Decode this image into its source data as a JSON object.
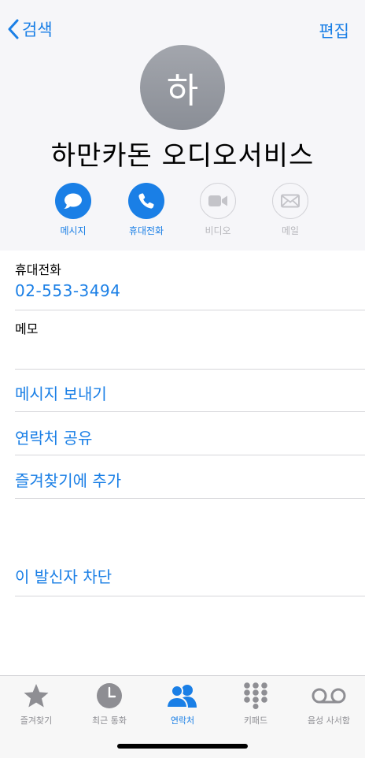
{
  "nav": {
    "back_label": "검색",
    "edit_label": "편집"
  },
  "contact": {
    "avatar_initial": "하",
    "name": "하만카돈 오디오서비스"
  },
  "actions": [
    {
      "label": "메시지",
      "icon": "message-bubble-icon",
      "enabled": true
    },
    {
      "label": "휴대전화",
      "icon": "phone-icon",
      "enabled": true
    },
    {
      "label": "비디오",
      "icon": "video-icon",
      "enabled": false
    },
    {
      "label": "메일",
      "icon": "mail-icon",
      "enabled": false
    }
  ],
  "phone": {
    "label": "휴대전화",
    "value": "02-553-3494"
  },
  "memo": {
    "label": "메모"
  },
  "links": {
    "send_message": "메시지 보내기",
    "share_contact": "연락처 공유",
    "add_favorite": "즐겨찾기에 추가",
    "block_caller": "이 발신자 차단"
  },
  "tabbar": [
    {
      "label": "즐겨찾기",
      "icon": "star-icon",
      "active": false
    },
    {
      "label": "최근 통화",
      "icon": "clock-icon",
      "active": false
    },
    {
      "label": "연락처",
      "icon": "contacts-icon",
      "active": true
    },
    {
      "label": "키패드",
      "icon": "keypad-icon",
      "active": false
    },
    {
      "label": "음성 사서함",
      "icon": "voicemail-icon",
      "active": false
    }
  ],
  "colors": {
    "accent": "#1a7fe6",
    "header_bg": "#f6f6f9",
    "avatar": "#9a9da4",
    "inactive_tab": "#8e8e93"
  }
}
